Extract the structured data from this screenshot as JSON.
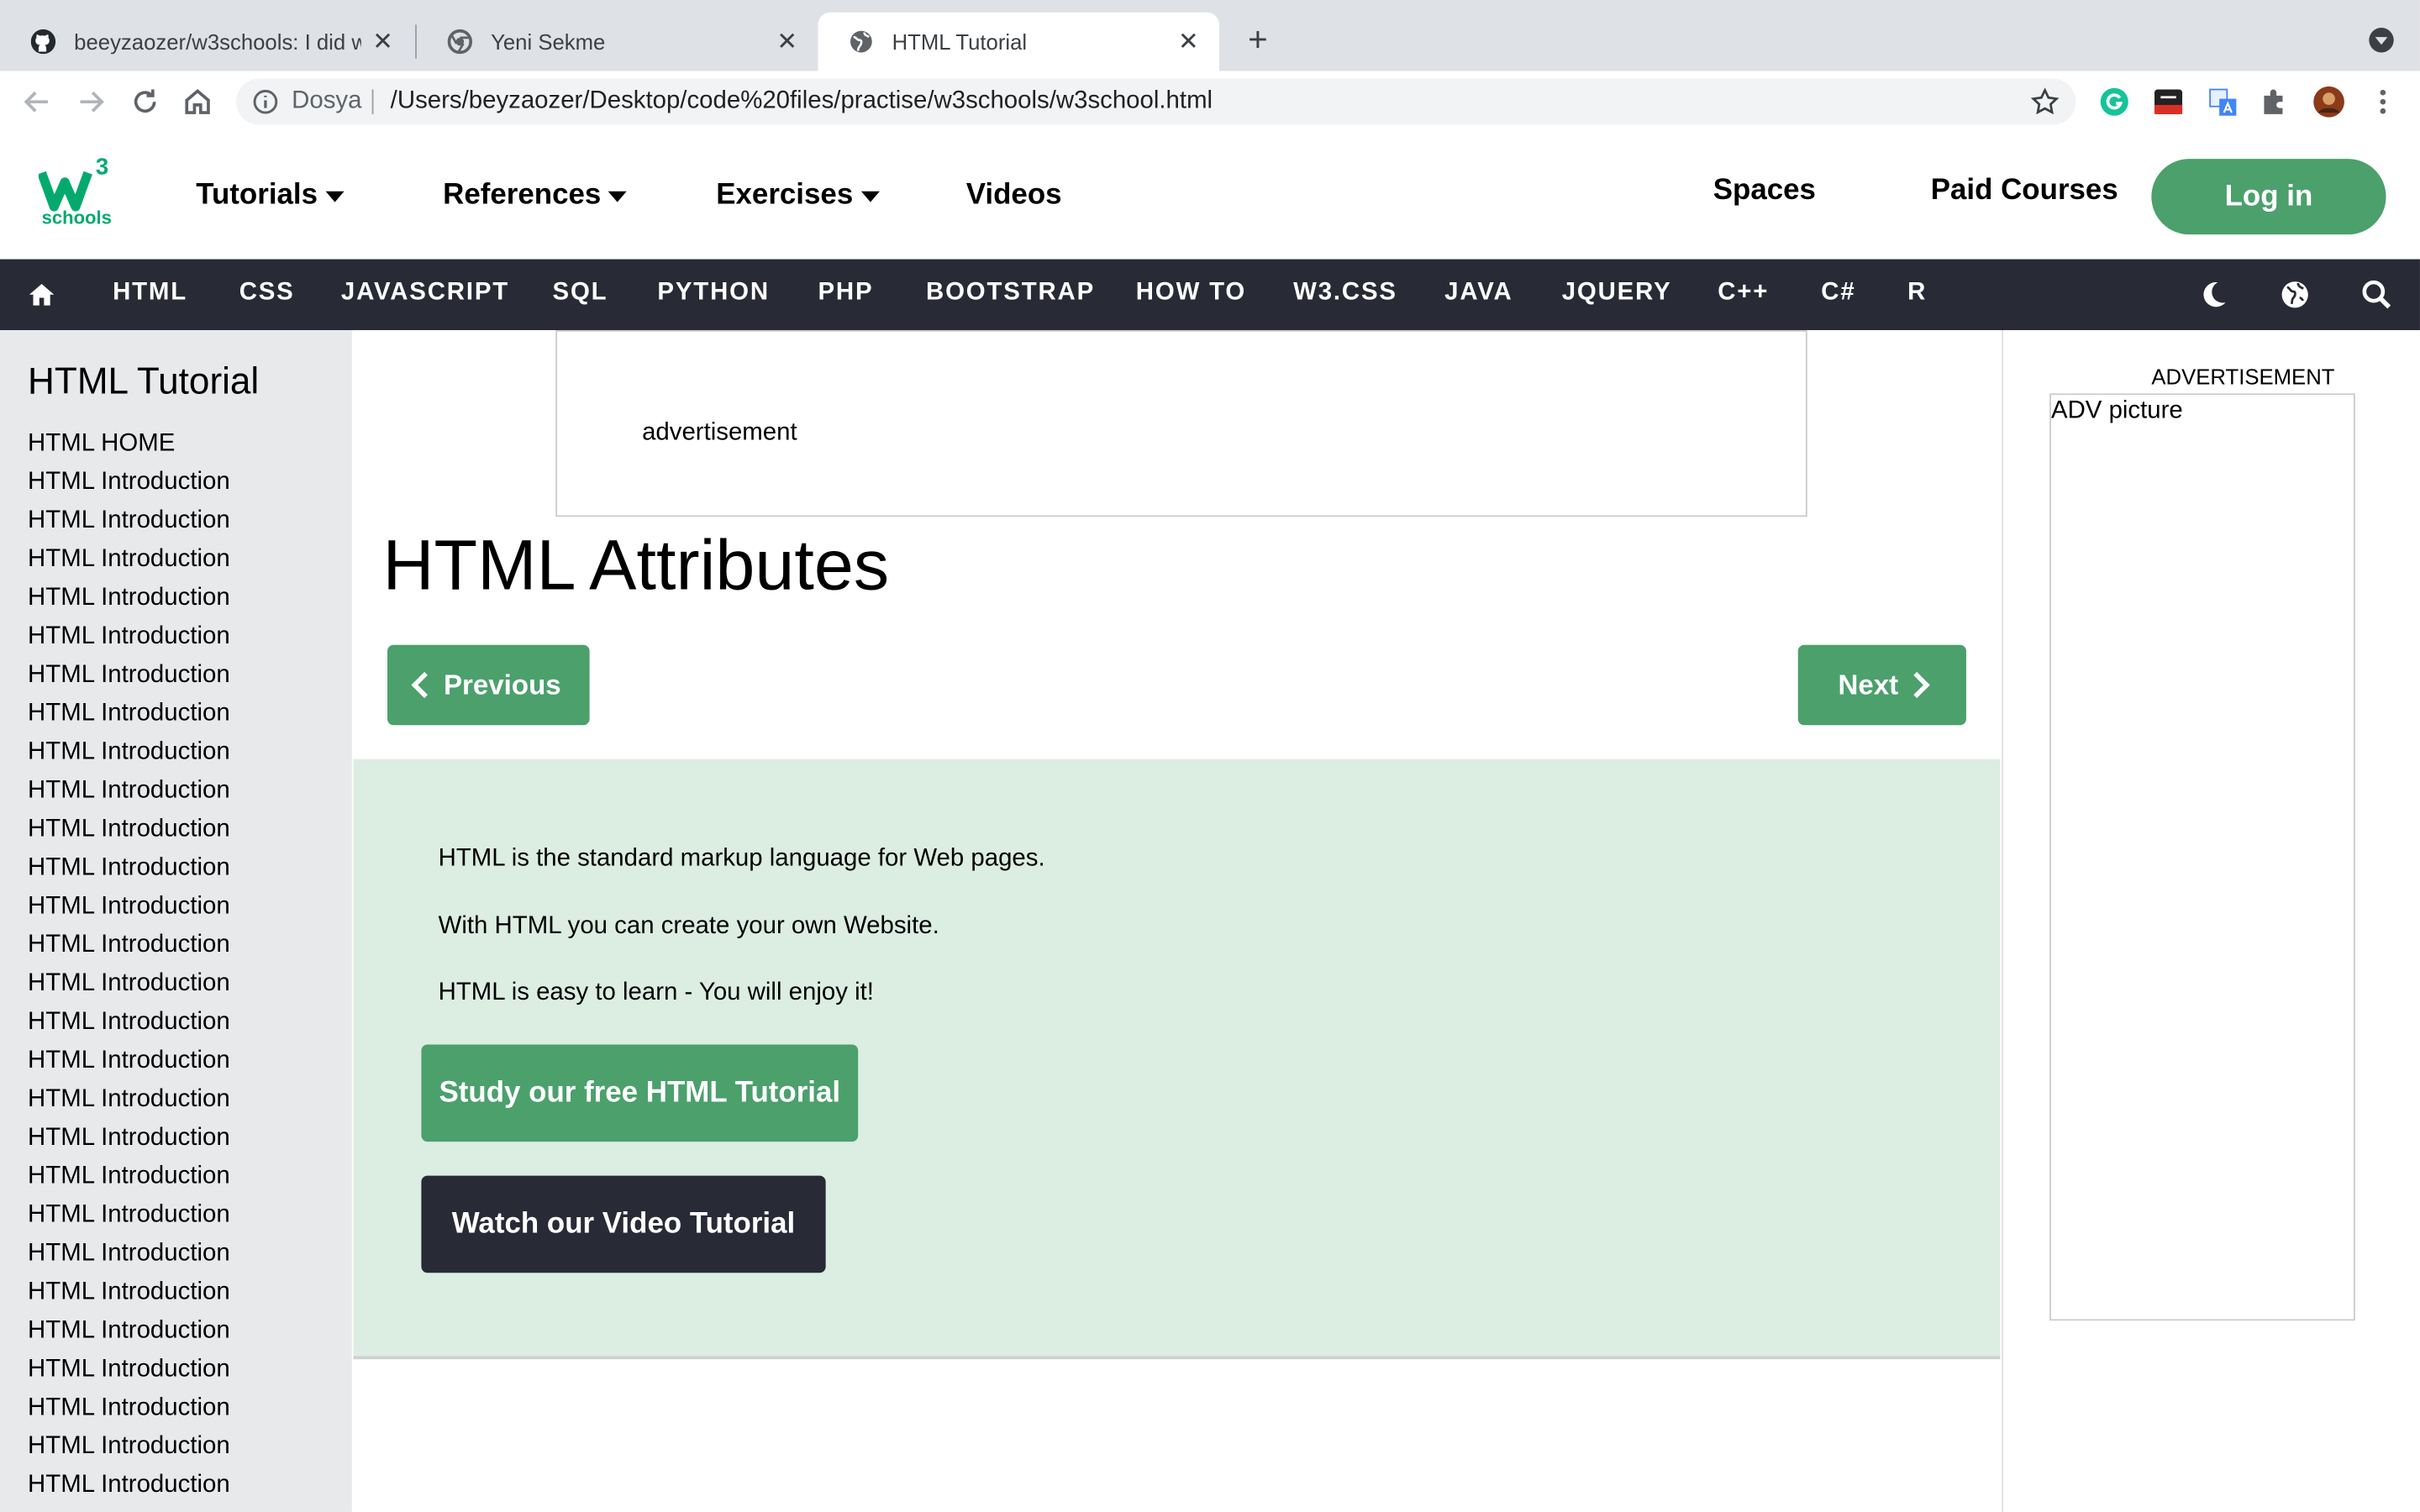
{
  "browser": {
    "tabs": [
      {
        "label": "beeyzaozer/w3schools: I did w",
        "icon": "github-icon",
        "active": false
      },
      {
        "label": "Yeni Sekme",
        "icon": "chrome-icon",
        "active": false
      },
      {
        "label": "HTML Tutorial",
        "icon": "globe-icon",
        "active": true
      }
    ],
    "site_label": "Dosya",
    "url": "/Users/beyzaozer/Desktop/code%20files/practise/w3schools/w3school.html"
  },
  "topnav": {
    "logo_text": "schools",
    "logo_sup": "3",
    "tutorials": "Tutorials",
    "references": "References",
    "exercises": "Exercises",
    "videos": "Videos",
    "spaces": "Spaces",
    "paid_courses": "Paid Courses",
    "login": "Log in",
    "brand_color": "#04aa6d"
  },
  "subnav": {
    "items": [
      "HTML",
      "CSS",
      "JAVASCRIPT",
      "SQL",
      "PYTHON",
      "PHP",
      "BOOTSTRAP",
      "HOW TO",
      "W3.CSS",
      "JAVA",
      "JQUERY",
      "C++",
      "C#",
      "R"
    ],
    "background": "#282a35"
  },
  "sidebar": {
    "title": "HTML Tutorial",
    "items": [
      "HTML HOME",
      "HTML Introduction",
      "HTML Introduction",
      "HTML Introduction",
      "HTML Introduction",
      "HTML Introduction",
      "HTML Introduction",
      "HTML Introduction",
      "HTML Introduction",
      "HTML Introduction",
      "HTML Introduction",
      "HTML Introduction",
      "HTML Introduction",
      "HTML Introduction",
      "HTML Introduction",
      "HTML Introduction",
      "HTML Introduction",
      "HTML Introduction",
      "HTML Introduction",
      "HTML Introduction",
      "HTML Introduction",
      "HTML Introduction",
      "HTML Introduction",
      "HTML Introduction",
      "HTML Introduction",
      "HTML Introduction",
      "HTML Introduction",
      "HTML Introduction"
    ]
  },
  "main": {
    "ad_text": "advertisement",
    "title": "HTML Attributes",
    "previous": "Previous",
    "next": "Next",
    "paragraphs": [
      "HTML is the standard markup language for Web pages.",
      "With HTML you can create your own Website.",
      "HTML is easy to learn - You will enjoy it!"
    ],
    "study_button": "Study our free HTML Tutorial",
    "video_button": "Watch our Video Tutorial",
    "panel_color": "#dcede2",
    "button_color": "#4ba06c"
  },
  "right_ad": {
    "label": "ADVERTISEMENT",
    "picture": "ADV picture"
  }
}
